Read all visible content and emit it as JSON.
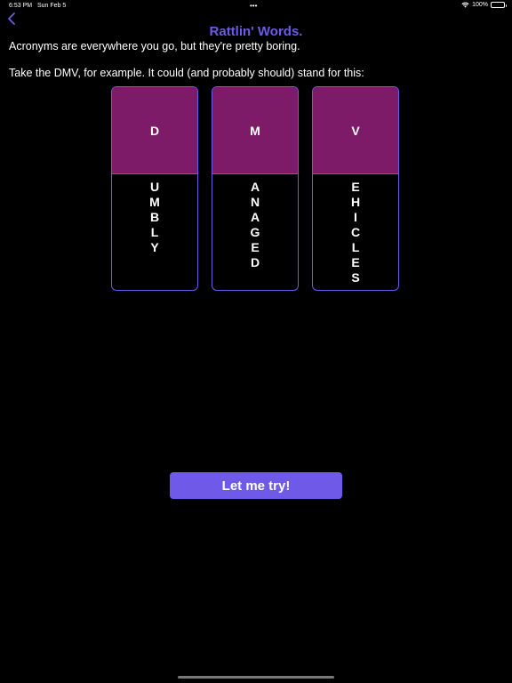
{
  "status_bar": {
    "time": "6:53 PM",
    "date": "Sun Feb 5",
    "dots": "•••",
    "battery": "100%"
  },
  "header": {
    "title": "Rattlin' Words."
  },
  "intro": {
    "line1": "Acronyms are everywhere you go, but they're pretty boring.",
    "line2": "Take the DMV, for example. It could (and probably should) stand for this:"
  },
  "cards": [
    {
      "initial": "D",
      "letters": [
        "U",
        "M",
        "B",
        "L",
        "Y"
      ]
    },
    {
      "initial": "M",
      "letters": [
        "A",
        "N",
        "A",
        "G",
        "E",
        "D"
      ]
    },
    {
      "initial": "V",
      "letters": [
        "E",
        "H",
        "I",
        "C",
        "L",
        "E",
        "S"
      ]
    }
  ],
  "actions": {
    "try_label": "Let me try!"
  },
  "colors": {
    "accent": "#6e59e8",
    "card_top": "#7e1b68",
    "background": "#000000"
  }
}
